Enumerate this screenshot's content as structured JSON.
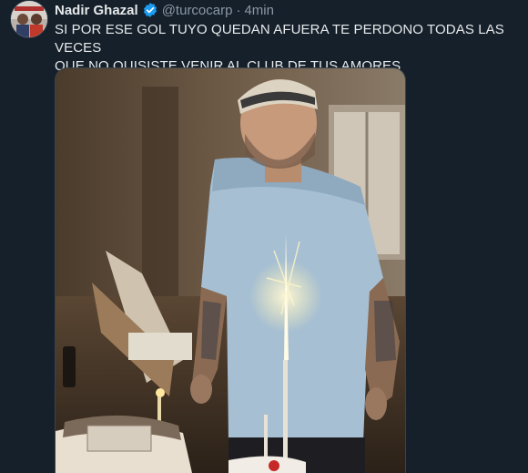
{
  "tweet": {
    "author": {
      "display_name": "Nadir Ghazal",
      "handle": "@turcocarp",
      "verified": true,
      "avatar_icon": "avatar-photo"
    },
    "separator": "·",
    "time": "4min",
    "text_lines": [
      "SI POR ESE GOL TUYO QUEDAN AFUERA TE PERDONO TODAS LAS VECES",
      "QUE NO QUISISTE VENIR AL CLUB DE TUS AMORES"
    ],
    "media": {
      "kind": "photo",
      "icon": "photo-man-with-birthday-cake"
    }
  },
  "colors": {
    "background": "#15202b",
    "text": "#e7e9ea",
    "muted": "#8b98a5",
    "verified": "#1d9bf0"
  }
}
